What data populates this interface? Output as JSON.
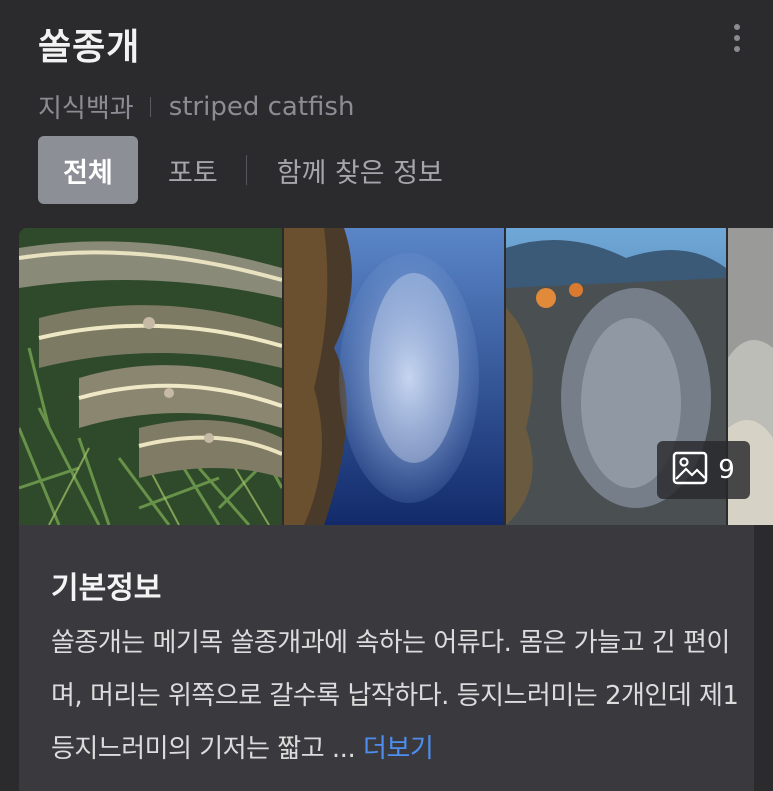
{
  "header": {
    "title": "쏠종개",
    "source": "지식백과",
    "english_name": "striped catfish",
    "more_icon": "more-vertical-icon"
  },
  "tabs": [
    {
      "label": "전체",
      "active": true
    },
    {
      "label": "포토",
      "active": false
    },
    {
      "label": "함께 찾은 정보",
      "active": false
    }
  ],
  "gallery": {
    "photo_count": "9",
    "count_icon": "image-icon",
    "photos": [
      "striped-catfish-school-seagrass",
      "fish-ball-underwater-blue",
      "reef-fish-school",
      "sandy-seafloor"
    ]
  },
  "info": {
    "title": "기본정보",
    "text": "쏠종개는 메기목 쏠종개과에 속하는 어류다. 몸은 가늘고 긴 편이며, 머리는 위쪽으로 갈수록 납작하다. 등지느러미는 2개인데 제1등지느러미의 기저는 짧고 ...",
    "more_link": "더보기"
  },
  "colors": {
    "background": "#2b2b2e",
    "card": "#3a3a3e",
    "active_tab": "#8d8f96",
    "link": "#4d8ef0"
  }
}
